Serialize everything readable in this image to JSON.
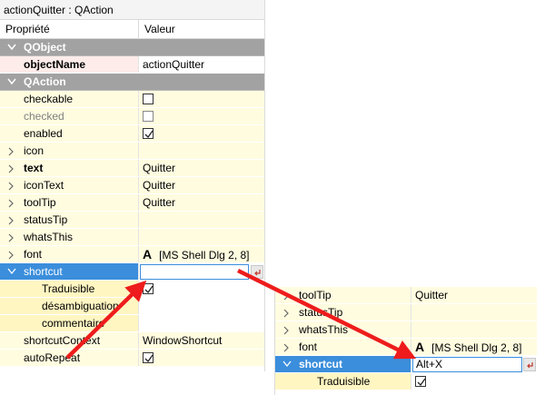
{
  "editor_title": "actionQuitter : QAction",
  "headers": {
    "property": "Propriété",
    "value": "Valeur"
  },
  "categories": {
    "qobject": "QObject",
    "qaction": "QAction"
  },
  "properties": {
    "objectName": {
      "label": "objectName",
      "value": "actionQuitter"
    },
    "checkable": {
      "label": "checkable",
      "checked": false
    },
    "checked": {
      "label": "checked",
      "checked": false
    },
    "enabled": {
      "label": "enabled",
      "checked": true
    },
    "icon": {
      "label": "icon",
      "value": ""
    },
    "text": {
      "label": "text",
      "value": "Quitter"
    },
    "iconText": {
      "label": "iconText",
      "value": "Quitter"
    },
    "toolTip": {
      "label": "toolTip",
      "value": "Quitter"
    },
    "statusTip": {
      "label": "statusTip",
      "value": ""
    },
    "whatsThis": {
      "label": "whatsThis",
      "value": ""
    },
    "font": {
      "label": "font",
      "glyph": "A",
      "value": "[MS Shell Dlg 2, 8]"
    },
    "shortcut": {
      "label": "shortcut",
      "value": ""
    },
    "traduisible": {
      "label": "Traduisible",
      "checked": true
    },
    "desambiguation": {
      "label": "désambiguation",
      "value": ""
    },
    "commentaire": {
      "label": "commentaire",
      "value": ""
    },
    "shortcutContext": {
      "label": "shortcutContext",
      "value": "WindowShortcut"
    },
    "autoRepeat": {
      "label": "autoRepeat",
      "checked": true
    }
  },
  "zoom": {
    "toolTip": {
      "label": "toolTip",
      "value": "Quitter"
    },
    "statusTip": {
      "label": "statusTip"
    },
    "whatsThis": {
      "label": "whatsThis"
    },
    "font": {
      "label": "font",
      "glyph": "A",
      "value": "[MS Shell Dlg 2, 8]"
    },
    "shortcut": {
      "label": "shortcut",
      "value": "Alt+X"
    },
    "traduisible": {
      "label": "Traduisible",
      "checked": true
    }
  },
  "colors": {
    "category_bg": "#a2a2a2",
    "selection": "#3b8edb",
    "annotation_arrow": "#ee1c1c",
    "row_yellow": "#fffce0",
    "row_pink": "#fdecea"
  }
}
